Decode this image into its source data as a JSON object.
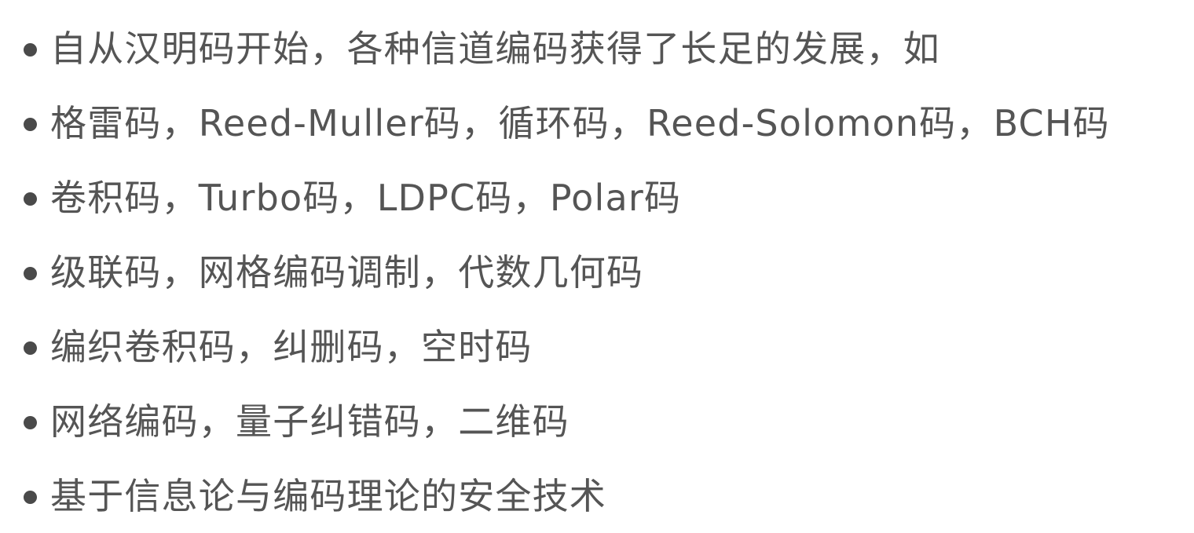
{
  "bullets": [
    {
      "text": "自从汉明码开始，各种信道编码获得了长足的发展，如"
    },
    {
      "text": "格雷码，Reed-Muller码，循环码，Reed-Solomon码，BCH码"
    },
    {
      "text": "卷积码，Turbo码，LDPC码，Polar码"
    },
    {
      "text": "级联码，网格编码调制，代数几何码"
    },
    {
      "text": "编织卷积码，纠删码，空时码"
    },
    {
      "text": "网络编码，量子纠错码，二维码"
    },
    {
      "text": "基于信息论与编码理论的安全技术"
    }
  ]
}
